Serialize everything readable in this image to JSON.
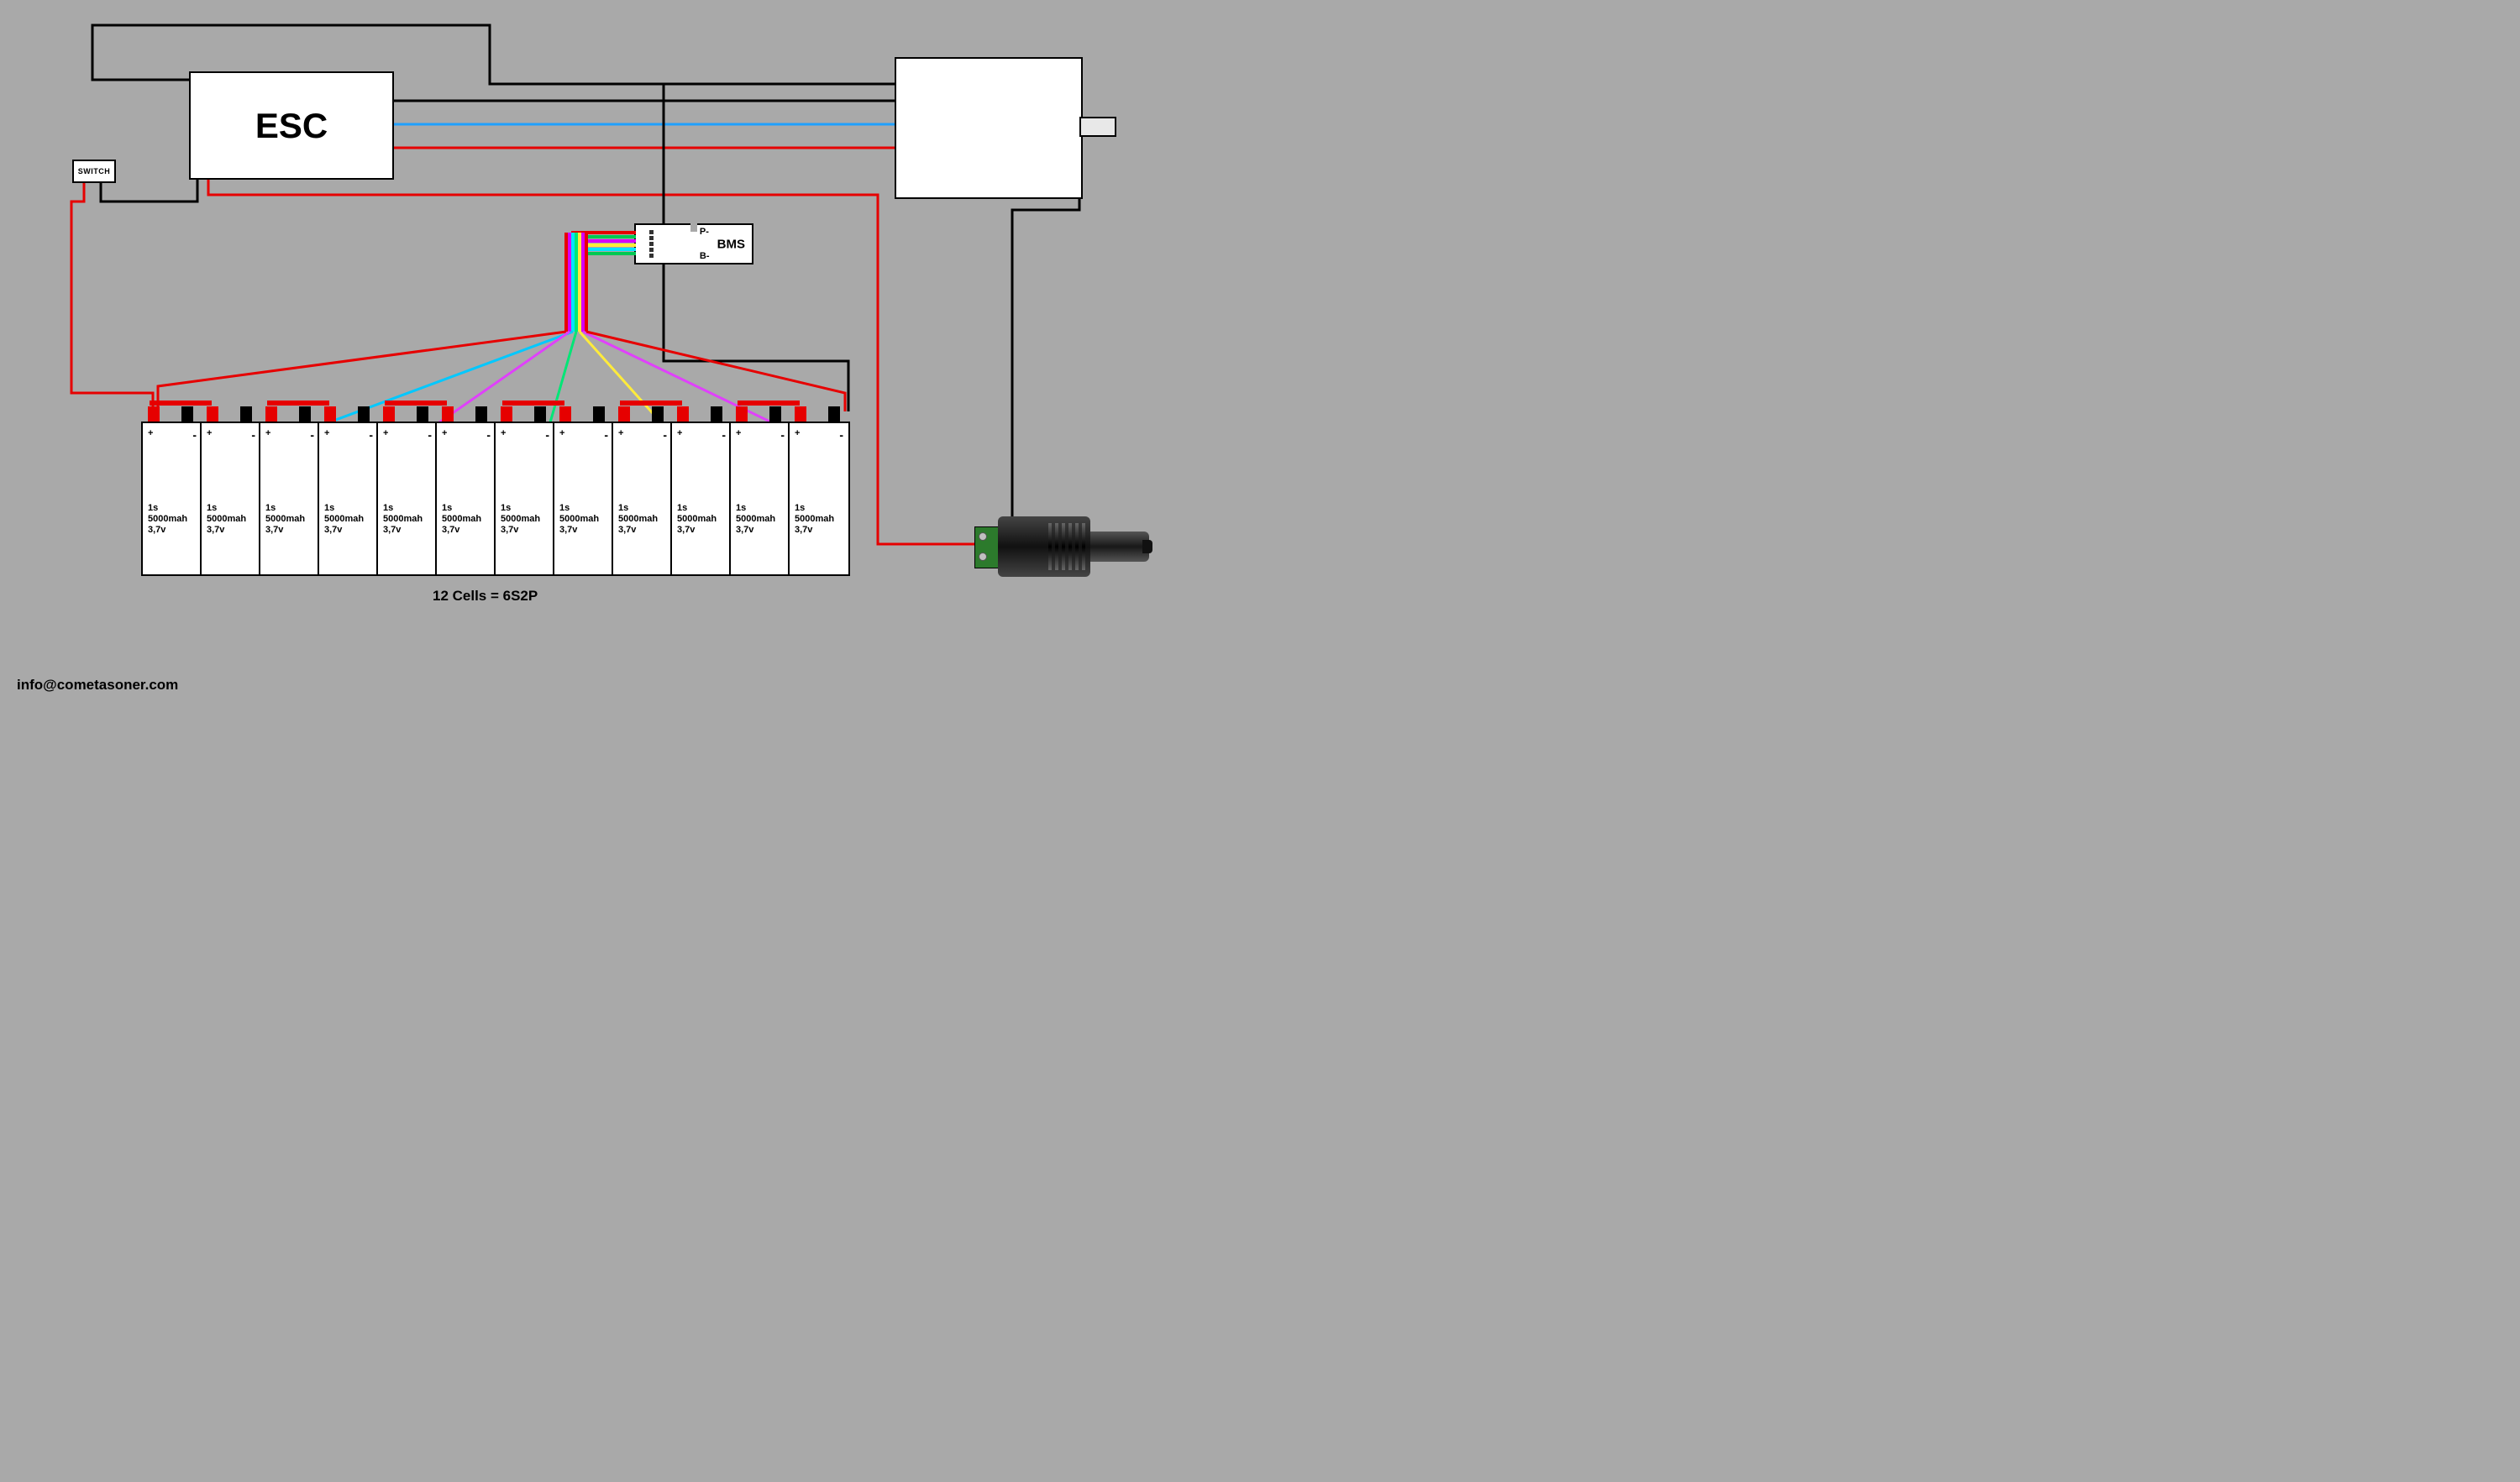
{
  "labels": {
    "esc": "ESC",
    "switch": "SWITCH",
    "bms": "BMS",
    "bms_p": "P-",
    "bms_b": "B-",
    "pack": "12 Cells = 6S2P",
    "contact": "info@cometasoner.com"
  },
  "cell": {
    "plus": "+",
    "minus": "-",
    "line1": "1s",
    "line2": "5000mah",
    "line3": "3,7v",
    "count": 12
  },
  "diagram": {
    "battery_config": "6S2P",
    "cell_count": 12,
    "cell_series": "1s",
    "cell_capacity_mah": 5000,
    "cell_voltage_v": 3.7,
    "components": [
      "ESC",
      "SWITCH",
      "MOTOR",
      "BMS",
      "DC-JACK",
      "BATTERY-PACK"
    ],
    "balance_wire_colors": [
      "red",
      "cyan",
      "magenta",
      "lime",
      "yellow",
      "magenta",
      "red"
    ],
    "phase_wire_colors": [
      "black",
      "deepskyblue",
      "red"
    ]
  }
}
